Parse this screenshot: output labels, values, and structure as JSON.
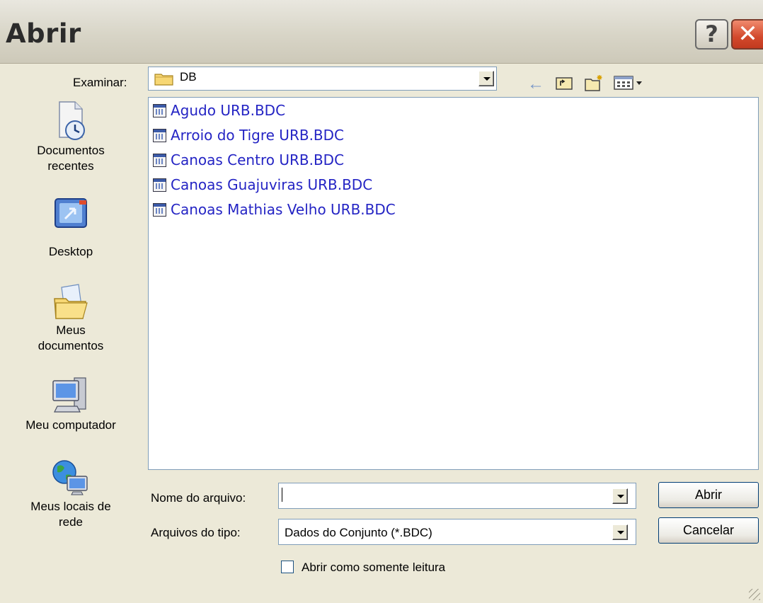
{
  "window": {
    "title": "Abrir",
    "help_label": "?",
    "close_label": "✕"
  },
  "look_in": {
    "label": "Examinar:",
    "value": "DB"
  },
  "toolbar_icons": [
    "back-arrow-icon",
    "up-folder-icon",
    "new-folder-icon",
    "view-menu-icon"
  ],
  "places": [
    {
      "label1": "Documentos",
      "label2": "recentes",
      "icon": "recent-documents-icon"
    },
    {
      "label1": "Desktop",
      "label2": "",
      "icon": "desktop-icon"
    },
    {
      "label1": "Meus",
      "label2": "documentos",
      "icon": "my-documents-icon"
    },
    {
      "label1": "Meu computador",
      "label2": "",
      "icon": "my-computer-icon"
    },
    {
      "label1": "Meus locais de",
      "label2": "rede",
      "icon": "network-places-icon"
    }
  ],
  "files": [
    {
      "name": "Agudo URB.BDC"
    },
    {
      "name": "Arroio do Tigre URB.BDC"
    },
    {
      "name": "Canoas Centro URB.BDC"
    },
    {
      "name": "Canoas Guajuviras URB.BDC"
    },
    {
      "name": "Canoas Mathias Velho URB.BDC"
    }
  ],
  "filename": {
    "label": "Nome do arquivo:",
    "value": ""
  },
  "filetype": {
    "label": "Arquivos do tipo:",
    "value": "Dados do Conjunto (*.BDC)"
  },
  "readonly": {
    "label": "Abrir como somente leitura",
    "checked": false
  },
  "buttons": {
    "open": "Abrir",
    "cancel": "Cancelar"
  }
}
